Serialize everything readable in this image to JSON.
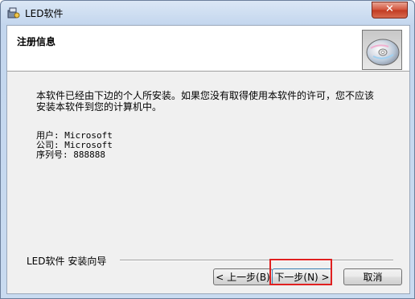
{
  "window": {
    "title": "LED软件",
    "close_label": "✕"
  },
  "header": {
    "title": "注册信息"
  },
  "body": {
    "text": "本软件已经由下边的个人所安装。如果您没有取得使用本软件的许可，您不应该安装本软件到您的计算机中。"
  },
  "info": {
    "user": "用户: Microsoft",
    "company": "公司: Microsoft",
    "serial": "序列号: 888888"
  },
  "footer": {
    "brand": "LED软件 安装向导"
  },
  "buttons": {
    "back": "< 上一步(B)",
    "next": "下一步(N) >",
    "cancel": "取消"
  },
  "colors": {
    "highlight": "#e02020",
    "close": "#c13a22"
  }
}
